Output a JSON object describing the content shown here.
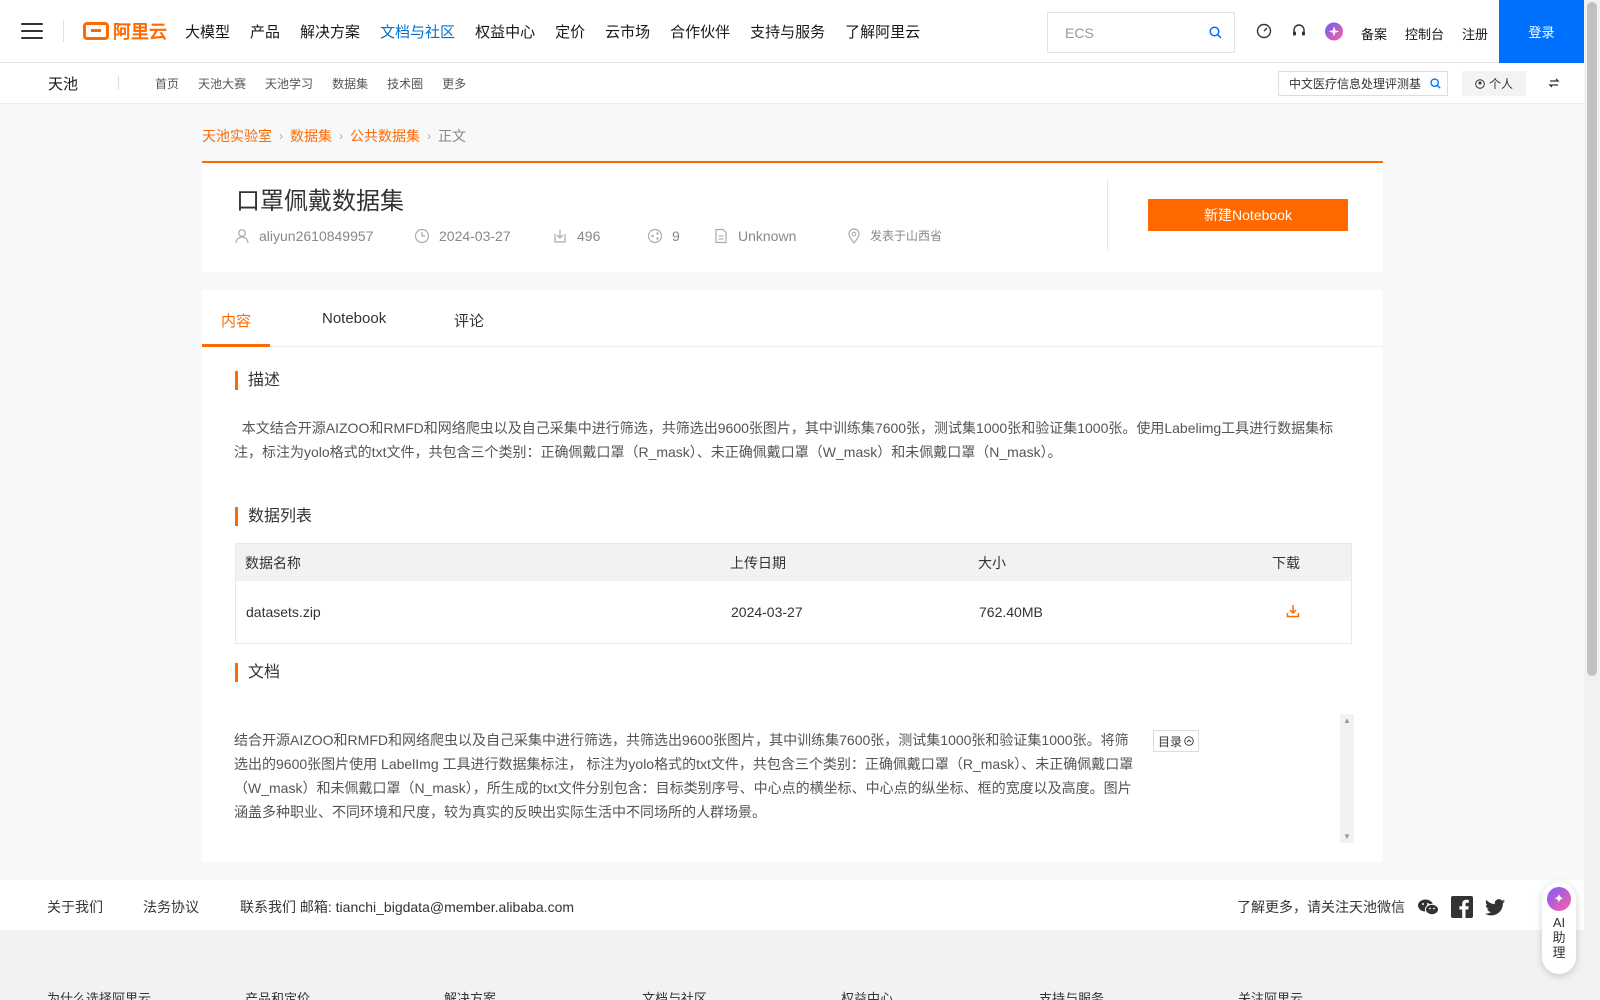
{
  "topnav": {
    "logo_text": "阿里云",
    "items": [
      {
        "label": "大模型"
      },
      {
        "label": "产品"
      },
      {
        "label": "解决方案"
      },
      {
        "label": "文档与社区",
        "active": true
      },
      {
        "label": "权益中心"
      },
      {
        "label": "定价"
      },
      {
        "label": "云市场"
      },
      {
        "label": "合作伙伴"
      },
      {
        "label": "支持与服务"
      },
      {
        "label": "了解阿里云"
      }
    ],
    "search_placeholder": "ECS",
    "links": [
      "备案",
      "控制台",
      "注册"
    ],
    "login_label": "登录",
    "accent_color": "#0070ff"
  },
  "subnav": {
    "brand": "天池",
    "links": [
      "首页",
      "天池大赛",
      "天池学习",
      "数据集",
      "技术圈",
      "更多"
    ],
    "search_value": "中文医疗信息处理评测基",
    "personal_label": "个人"
  },
  "breadcrumb": [
    "天池实验室",
    "数据集",
    "公共数据集",
    "正文"
  ],
  "dataset": {
    "title": "口罩佩戴数据集",
    "author": "aliyun2610849957",
    "date": "2024-03-27",
    "downloads": "496",
    "shares": "9",
    "license": "Unknown",
    "location": "发表于山西省",
    "new_notebook_label": "新建Notebook"
  },
  "tabs": [
    {
      "label": "内容",
      "active": true
    },
    {
      "label": "Notebook"
    },
    {
      "label": "评论"
    }
  ],
  "sections": {
    "description_title": "描述",
    "description_text": "本文结合开源AIZOO和RMFD和网络爬虫以及自己采集中进行筛选，共筛选出9600张图片，其中训练集7600张，测试集1000张和验证集1000张。使用Labelimg工具进行数据集标注，标注为yolo格式的txt文件，共包含三个类别：正确佩戴口罩（R_mask）、未正确佩戴口罩（W_mask）和未佩戴口罩（N_mask）。",
    "datalist_title": "数据列表",
    "doc_title": "文档",
    "doc_text": "结合开源AIZOO和RMFD和网络爬虫以及自己采集中进行筛选，共筛选出9600张图片，其中训练集7600张，测试集1000张和验证集1000张。将筛选出的9600张图片使用 LabelImg 工具进行数据集标注， 标注为yolo格式的txt文件，共包含三个类别：正确佩戴口罩（R_mask）、未正确佩戴口罩（W_mask）和未佩戴口罩（N_mask），所生成的txt文件分别包含：目标类别序号、中心点的横坐标、中心点的纵坐标、框的宽度以及高度。图片涵盖多种职业、不同环境和尺度，较为真实的反映出实际生活中不同场所的人群场景。",
    "toc_label": "目录"
  },
  "table": {
    "headers": [
      "数据名称",
      "上传日期",
      "大小",
      "下载"
    ],
    "rows": [
      {
        "name": "datasets.zip",
        "date": "2024-03-27",
        "size": "762.40MB"
      }
    ]
  },
  "footer": {
    "links": [
      "关于我们",
      "法务协议",
      "联系我们 邮箱: tianchi_bigdata@member.alibaba.com"
    ],
    "wechat_text": "了解更多，请关注天池微信",
    "bottom_cols": [
      "为什么选择阿里云",
      "产品和定价",
      "解决方案",
      "文档与社区",
      "权益中心",
      "支持与服务",
      "关注阿里云"
    ]
  },
  "ai_assistant": {
    "label": "AI助理"
  },
  "colors": {
    "brand_orange": "#ff6a00",
    "link_blue": "#0070cc"
  }
}
